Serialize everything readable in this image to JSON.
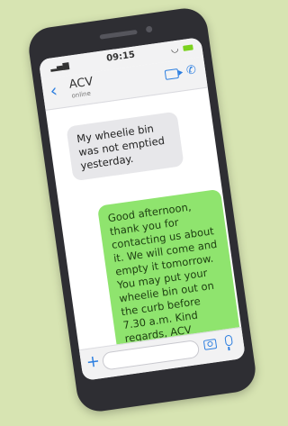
{
  "status_bar": {
    "time": "09:15",
    "signal_icon": "signal-icon",
    "wifi_icon": "wifi-icon",
    "battery_icon": "battery-icon"
  },
  "chat_header": {
    "back_icon": "back-chevron-icon",
    "contact_name": "ACV",
    "contact_status": "online",
    "video_icon": "video-call-icon",
    "phone_icon": "phone-call-icon"
  },
  "messages": [
    {
      "type": "incoming",
      "text": "My wheelie bin was not emptied yesterday."
    },
    {
      "type": "outgoing",
      "text": "Good afternoon, thank you for contacting us about it. We will come and empty it tomorrow. You may put your wheelie bin out on the curb before 7.30 a.m. Kind regards, ACV"
    }
  ],
  "input_bar": {
    "plus_icon": "plus-icon",
    "camera_icon": "camera-icon",
    "mic_icon": "microphone-icon"
  },
  "colors": {
    "background": "#d7e4b2",
    "outgoing_bubble": "#8fe46e",
    "incoming_bubble": "#e7e7ea",
    "accent": "#2d7fe0"
  }
}
